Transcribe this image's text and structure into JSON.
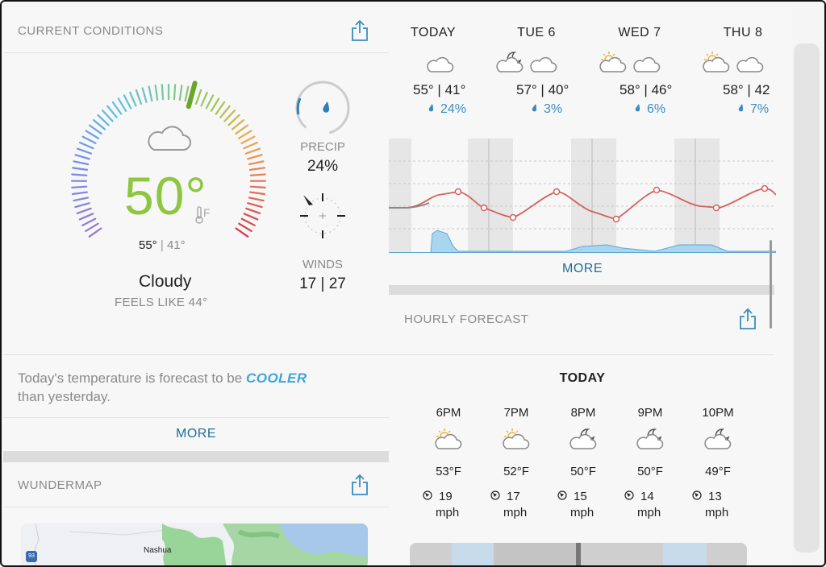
{
  "current": {
    "title": "CURRENT CONDITIONS",
    "temperature": "50°",
    "unit": "F",
    "high": "55°",
    "low": "41°",
    "condition": "Cloudy",
    "feels_like": "FEELS LIKE 44°",
    "precip_label": "PRECIP",
    "precip_value": "24%",
    "winds_label": "WINDS",
    "winds_value": "17 | 27",
    "summary_prefix": "Today's temperature is forecast to be ",
    "summary_highlight": "COOLER",
    "summary_suffix": "than yesterday.",
    "more": "MORE"
  },
  "wundermap": {
    "title": "WUNDERMAP",
    "place": "Nashua",
    "highway": "93"
  },
  "forecast": {
    "days": [
      {
        "name": "TODAY",
        "temps": "55° | 41°",
        "precip": "24%"
      },
      {
        "name": "TUE 6",
        "temps": "57° | 40°",
        "precip": "3%"
      },
      {
        "name": "WED 7",
        "temps": "58° | 46°",
        "precip": "6%"
      },
      {
        "name": "THU 8",
        "temps": "58° | 42",
        "precip": "7%"
      }
    ],
    "more": "MORE"
  },
  "hourly": {
    "title": "HOURLY FORECAST",
    "day_label": "TODAY",
    "hours": [
      {
        "time": "6PM",
        "temp": "53°F",
        "wind": "19",
        "unit": "mph",
        "icon": "partly-cloudy-day-icon"
      },
      {
        "time": "7PM",
        "temp": "52°F",
        "wind": "17",
        "unit": "mph",
        "icon": "partly-cloudy-day-icon"
      },
      {
        "time": "8PM",
        "temp": "50°F",
        "wind": "15",
        "unit": "mph",
        "icon": "partly-cloudy-night-icon"
      },
      {
        "time": "9PM",
        "temp": "50°F",
        "wind": "14",
        "unit": "mph",
        "icon": "partly-cloudy-night-icon"
      },
      {
        "time": "10PM",
        "temp": "49°F",
        "wind": "13",
        "unit": "mph",
        "icon": "partly-cloudy-night-icon"
      }
    ]
  },
  "colors": {
    "accent_blue": "#3aa7d8",
    "link_blue": "#1f6f9a",
    "temp_green": "#8dc63f",
    "chart_temp_line": "#d46060",
    "chart_precip_fill": "#a9d5ef"
  }
}
